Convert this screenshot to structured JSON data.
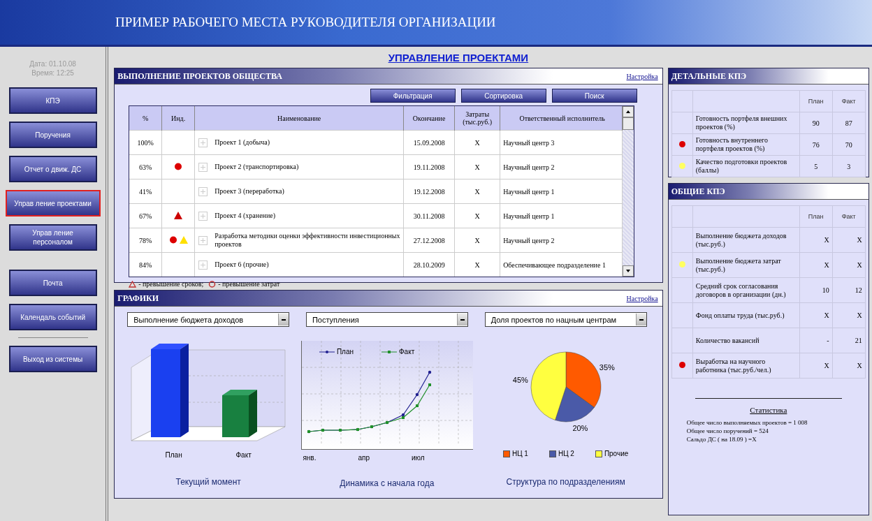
{
  "header": {
    "title": "ПРИМЕР РАБОЧЕГО МЕСТА РУКОВОДИТЕЛЯ ОРГАНИЗАЦИИ"
  },
  "sidebar": {
    "date": "Дата: 01.10.08",
    "time": "Время: 12:25",
    "groups": [
      {
        "divider": false,
        "buttons": [
          {
            "label": "КПЭ",
            "selected": false
          },
          {
            "label": "Поручения",
            "selected": false
          },
          {
            "label": "Отчет о движ. ДС",
            "selected": false
          },
          {
            "label": "Управ ление проектами",
            "selected": true
          },
          {
            "label": "Управ ление персоналом",
            "selected": false
          }
        ]
      },
      {
        "divider": true,
        "buttons": [
          {
            "label": "Почта",
            "selected": false
          },
          {
            "label": "Календаль событий",
            "selected": false
          }
        ]
      },
      {
        "divider": false,
        "buttons": [
          {
            "label": "Выход из системы",
            "selected": false
          }
        ]
      }
    ]
  },
  "page_title": "УПРАВЛЕНИЕ ПРОЕКТАМИ",
  "projects": {
    "title": "ВЫПОЛНЕНИЕ ПРОЕКТОВ ОБЩЕСТВА",
    "settings_link": "Настройка",
    "buttons": [
      "Фильтрация",
      "Сортировка",
      "Поиск"
    ],
    "columns": [
      "%",
      "Инд.",
      "Наименование",
      "Окончание",
      "Затраты (тыс.руб.)",
      "Ответственный исполнитель"
    ],
    "rows": [
      {
        "percent": "100%",
        "indicators": [],
        "name": "Проект 1 (добыча)",
        "end": "15.09.2008",
        "cost": "X",
        "owner": "Научный центр 3"
      },
      {
        "percent": "63%",
        "indicators": [
          {
            "kind": "circle",
            "color": "#dd0000"
          }
        ],
        "name": "Проект 2 (транспортировка)",
        "end": "19.11.2008",
        "cost": "X",
        "owner": "Научный центр 2"
      },
      {
        "percent": "41%",
        "indicators": [],
        "name": "Проект 3 (переработка)",
        "end": "19.12.2008",
        "cost": "X",
        "owner": "Научный центр 1"
      },
      {
        "percent": "67%",
        "indicators": [
          {
            "kind": "triangle",
            "color": "#cc0000"
          }
        ],
        "name": "Проект 4 (хранение)",
        "end": "30.11.2008",
        "cost": "X",
        "owner": "Научный центр 1"
      },
      {
        "percent": "78%",
        "indicators": [
          {
            "kind": "circle",
            "color": "#dd0000"
          },
          {
            "kind": "triangle",
            "color": "#ffe000"
          }
        ],
        "name": "Разработка методики оценки эффективности инвестиционных проектов",
        "end": "27.12.2008",
        "cost": "X",
        "owner": "Научный центр 2"
      },
      {
        "percent": "84%",
        "indicators": [],
        "name": "Проект 6 (прочие)",
        "end": "28.10.2009",
        "cost": "X",
        "owner": "Обеспечивающее подразделение 1"
      }
    ],
    "legend": [
      {
        "kind": "triangle",
        "text": "- превышение сроков;"
      },
      {
        "kind": "circle",
        "text": "- превышение затрат"
      }
    ]
  },
  "charts": {
    "title": "ГРАФИКИ",
    "settings_link": "Настройка",
    "dropdowns": [
      "Выполнение бюджета доходов",
      "Поступления",
      "Доля проектов по нацным центрам"
    ],
    "bar_labels": [
      "План",
      "Факт"
    ],
    "bar_caption": "Текущий момент",
    "line_legend": [
      "План",
      "Факт"
    ],
    "line_xlabels": [
      "янв.",
      "апр",
      "июл"
    ],
    "line_caption": "Динамика с начала года",
    "pie": {
      "chart_data": {
        "type": "pie",
        "categories": [
          "НЦ 1",
          "НЦ 2",
          "Прочие"
        ],
        "series": [
          {
            "values": [
              35,
              20,
              45
            ]
          }
        ],
        "value_labels": [
          "35%",
          "20%",
          "45%"
        ],
        "legend": "bottom"
      },
      "slices": [
        {
          "color": "#ff5a00"
        },
        {
          "color": "#4a5aa8"
        },
        {
          "color": "#ffff40"
        }
      ]
    },
    "pie_caption": "Структура по подразделениям"
  },
  "detailed_kpi": {
    "title": "ДЕТАЛЬНЫЕ КПЭ",
    "columns": [
      "План",
      "Факт"
    ],
    "rows": [
      {
        "name": "Готовность портфеля внешних проектов (%)",
        "plan": "90",
        "fact": "87"
      },
      {
        "name": "Готовность внутреннего портфеля проектов (%)",
        "plan": "76",
        "fact": "70",
        "color": "#dd0000"
      },
      {
        "name": "Качество подготовки проектов (баллы)",
        "plan": "5",
        "fact": "3",
        "color": "#ffff60"
      }
    ]
  },
  "general_kpi": {
    "title": "ОБЩИЕ КПЭ",
    "columns": [
      "План",
      "Факт"
    ],
    "rows": [
      {
        "name": "Выполнение бюджета доходов  (тыс.руб.)",
        "plan": "X",
        "fact": "X"
      },
      {
        "name": "Выполнение бюджета затрат (тыс.руб.)",
        "plan": "X",
        "fact": "X",
        "color": "#ffff60"
      },
      {
        "name": "Средний срок согласования договоров  в организации (дн.)",
        "plan": "10",
        "fact": "12"
      },
      {
        "name": "Фонд оплаты труда (тыс.руб.)",
        "plan": "X",
        "fact": "X"
      },
      {
        "name": "Количество вакансий",
        "plan": "-",
        "fact": "21"
      },
      {
        "name": "Выработка на научного работника (тыс.руб./чел.)",
        "plan": "X",
        "fact": "X",
        "color": "#dd0000"
      }
    ]
  },
  "statistics": {
    "title": "Статистика",
    "lines": [
      "Общее число выполняемых проектов = 1 008",
      "Общее число поручений = 524",
      "Сальдо ДС ( на 18.09 ) =X"
    ]
  }
}
